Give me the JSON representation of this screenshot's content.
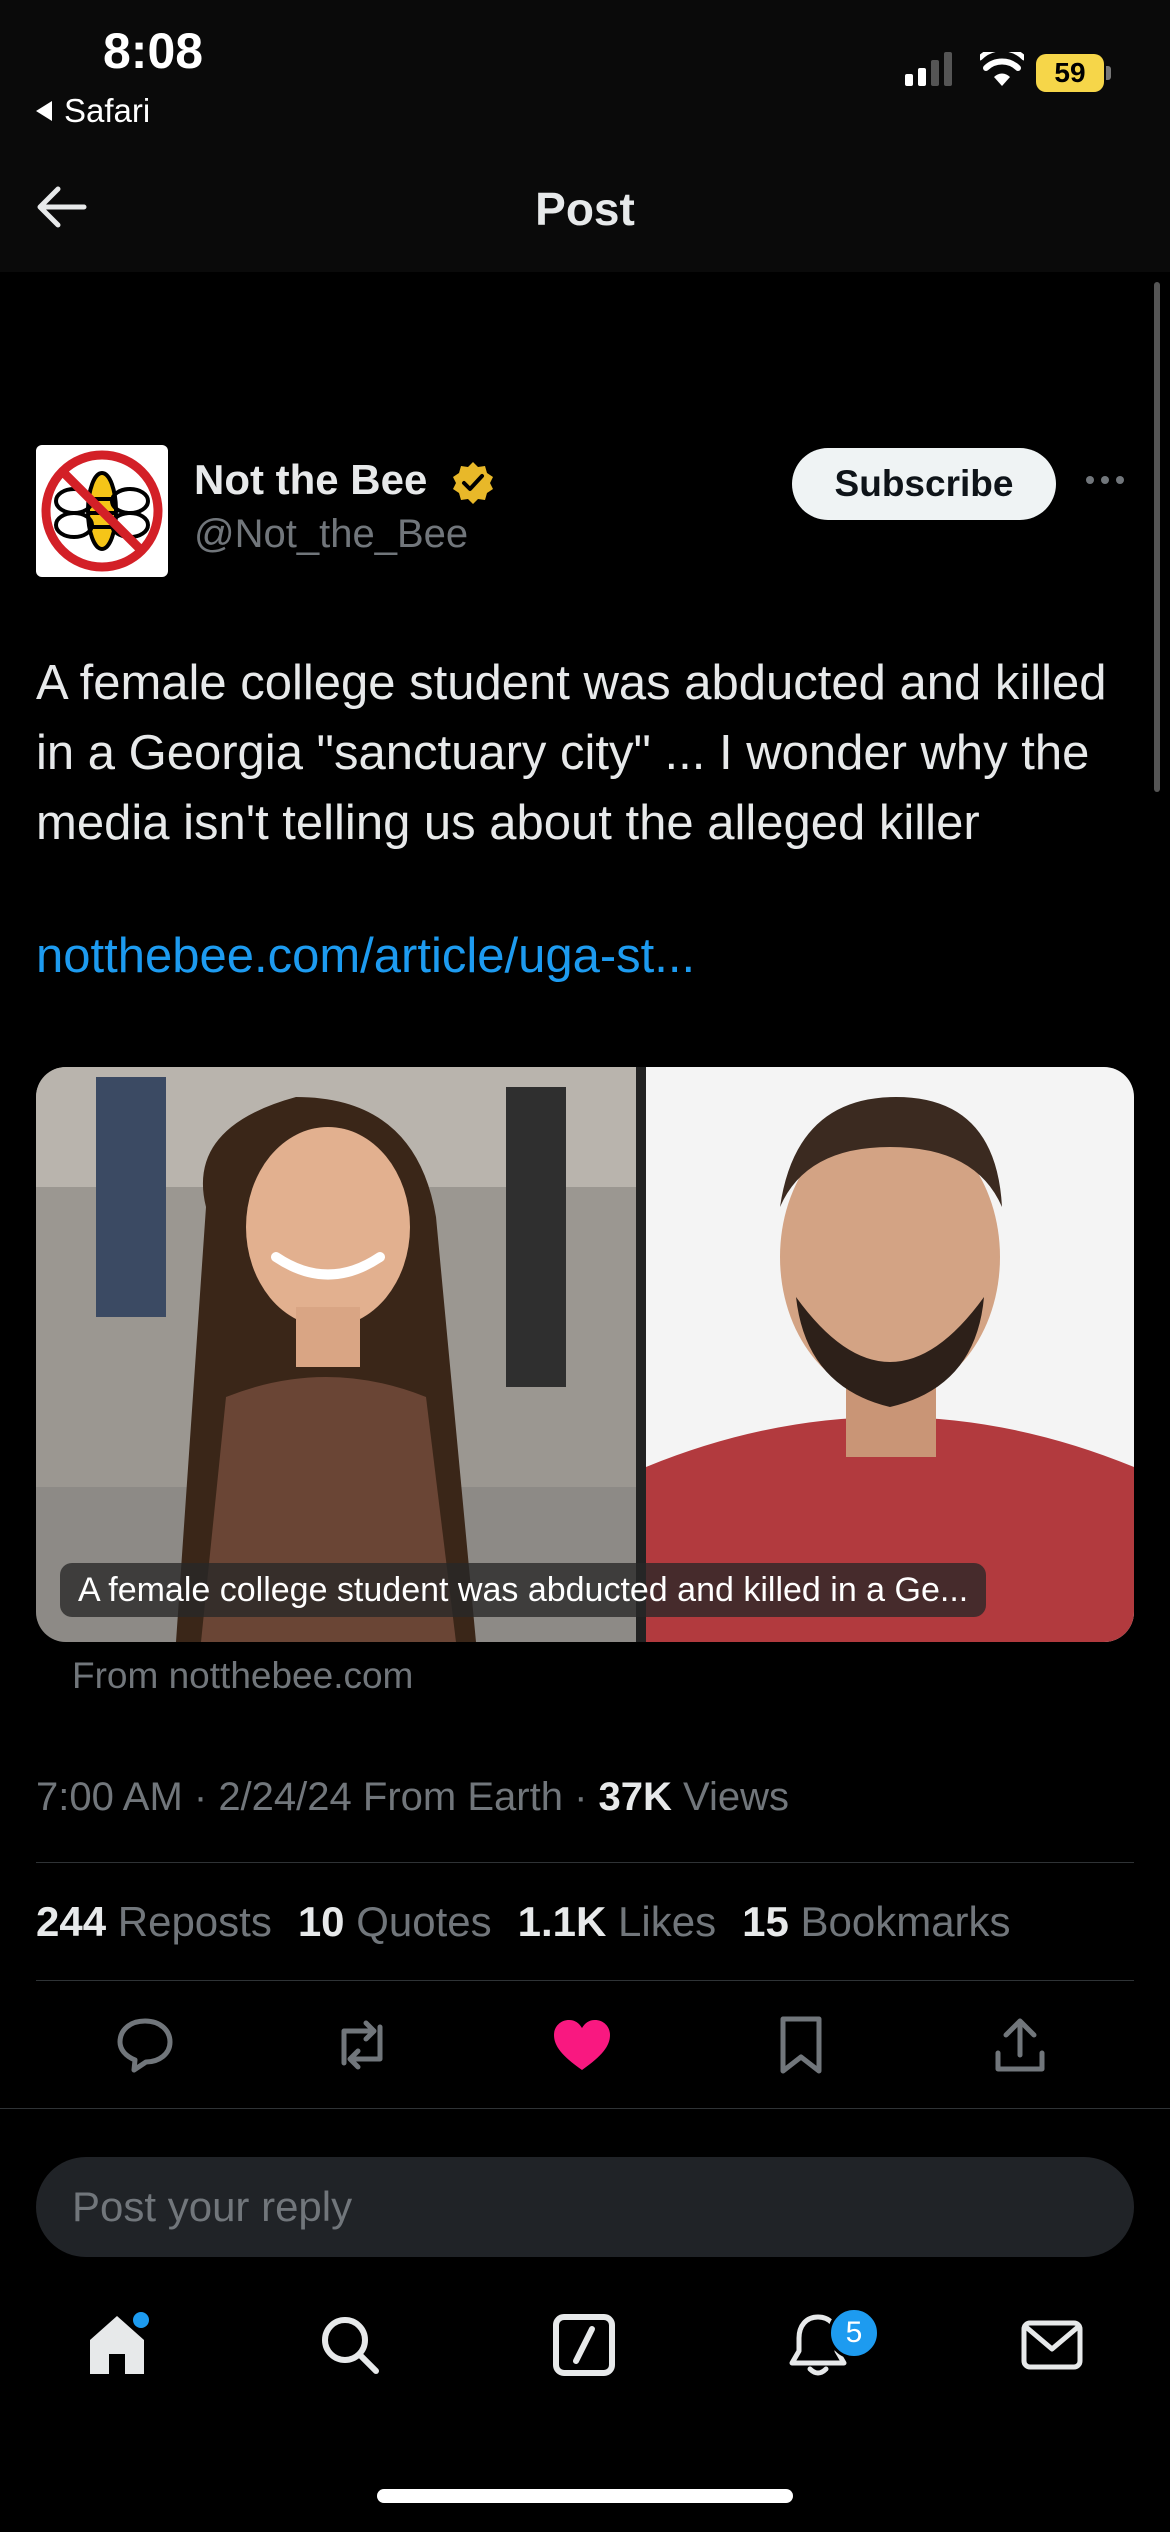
{
  "status_bar": {
    "time": "8:08",
    "back_app": "Safari",
    "battery": "59",
    "battery_color": "#f6d649"
  },
  "header": {
    "title": "Post",
    "back_icon": "arrow-left-icon"
  },
  "author": {
    "name": "Not the Bee",
    "handle": "@Not_the_Bee",
    "verified_color": "#e8b829",
    "subscribe_label": "Subscribe"
  },
  "post": {
    "text": "A female college student was abducted and killed in a Georgia \"sanctuary city\" ... I wonder why the media isn't telling us about the alleged killer",
    "link": "notthebee.com/article/uga-st...",
    "link_color": "#1d9bf0",
    "media_caption": "A female college student was abducted and killed in a Ge...",
    "from_label": "From notthebee.com",
    "time": "7:00 AM",
    "date": "2/24/24",
    "source": "From Earth",
    "views_count": "37K",
    "views_label": "Views"
  },
  "stats": {
    "reposts_count": "244",
    "reposts_label": "Reposts",
    "quotes_count": "10",
    "quotes_label": "Quotes",
    "likes_count": "1.1K",
    "likes_label": "Likes",
    "bookmarks_count": "15",
    "bookmarks_label": "Bookmarks"
  },
  "actions": {
    "icons": [
      "reply-icon",
      "repost-icon",
      "like-icon",
      "bookmark-icon",
      "share-icon"
    ],
    "like_color": "#f91880"
  },
  "reply": {
    "placeholder": "Post your reply"
  },
  "tabbar": {
    "icons": [
      "home-icon",
      "search-icon",
      "compose-icon",
      "notifications-icon",
      "messages-icon"
    ],
    "notification_badge": "5",
    "accent": "#1d9bf0"
  }
}
